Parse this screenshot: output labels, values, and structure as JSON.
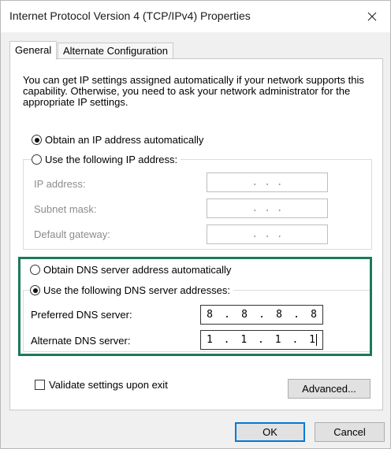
{
  "window": {
    "title": "Internet Protocol Version 4 (TCP/IPv4) Properties"
  },
  "tabs": [
    {
      "label": "General",
      "active": true
    },
    {
      "label": "Alternate Configuration",
      "active": false
    }
  ],
  "general": {
    "description": "You can get IP settings assigned automatically if your network supports this capability. Otherwise, you need to ask your network administrator for the appropriate IP settings.",
    "ip_auto_label": "Obtain an IP address automatically",
    "ip_manual_label": "Use the following IP address:",
    "ip_fields": [
      {
        "label": "IP address:",
        "value": ".   .   ."
      },
      {
        "label": "Subnet mask:",
        "value": ".   .   ."
      },
      {
        "label": "Default gateway:",
        "value": ".   .   ."
      }
    ],
    "dns_auto_label": "Obtain DNS server address automatically",
    "dns_manual_label": "Use the following DNS server addresses:",
    "dns_fields": [
      {
        "label": "Preferred DNS server:",
        "octets": [
          "8",
          ".",
          "8",
          ".",
          "8",
          ".",
          "8"
        ]
      },
      {
        "label": "Alternate DNS server:",
        "octets": [
          "1",
          ".",
          "1",
          ".",
          "1",
          ".",
          "1"
        ]
      }
    ],
    "validate_label": "Validate settings upon exit",
    "advanced_label": "Advanced..."
  },
  "footer": {
    "ok_label": "OK",
    "cancel_label": "Cancel"
  },
  "colors": {
    "highlight_border": "#1a7a5c",
    "default_button_border": "#0078d7"
  }
}
